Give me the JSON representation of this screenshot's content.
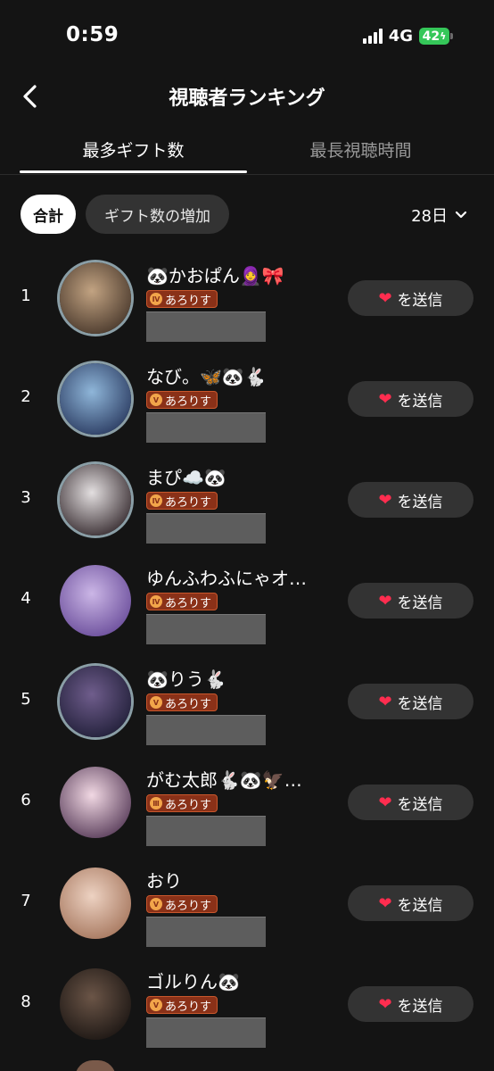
{
  "status_bar": {
    "time": "0:59",
    "network": "4G",
    "battery": "42"
  },
  "header": {
    "title": "視聴者ランキング"
  },
  "tabs": [
    {
      "label": "最多ギフト数",
      "active": true
    },
    {
      "label": "最長視聴時間",
      "active": false
    }
  ],
  "filters": {
    "chips": [
      {
        "label": "合計",
        "active": true
      },
      {
        "label": "ギフト数の増加",
        "active": false
      }
    ],
    "period": "28日"
  },
  "send_label": "を送信",
  "rows": [
    {
      "rank": "1",
      "name": "🐼かおぱん🧕🎀",
      "badge": "あろりす",
      "badge_level": "Ⅳ",
      "avatar_colors": [
        "#c2a382",
        "#4b3a2d"
      ],
      "framed": true
    },
    {
      "rank": "2",
      "name": "なび。🦋🐼🐇",
      "badge": "あろりす",
      "badge_level": "Ⅴ",
      "avatar_colors": [
        "#8fb6d9",
        "#2c3d63"
      ],
      "framed": true
    },
    {
      "rank": "3",
      "name": "まぴ☁️🐼",
      "badge": "あろりす",
      "badge_level": "Ⅳ",
      "avatar_colors": [
        "#e3dfe0",
        "#3a2f33"
      ],
      "framed": true
    },
    {
      "rank": "4",
      "name": "ゆんふわふにゃオ…",
      "badge": "あろりす",
      "badge_level": "Ⅳ",
      "avatar_colors": [
        "#cbb6e6",
        "#6c4f9c"
      ],
      "framed": false
    },
    {
      "rank": "5",
      "name": "🐼りう🐇",
      "badge": "あろりす",
      "badge_level": "Ⅴ",
      "avatar_colors": [
        "#6f5d8c",
        "#22203a"
      ],
      "framed": true
    },
    {
      "rank": "6",
      "name": "がむ太郎🐇🐼🦅…",
      "badge": "あろりす",
      "badge_level": "Ⅲ",
      "avatar_colors": [
        "#f1d8e3",
        "#5b3f5c"
      ],
      "framed": false
    },
    {
      "rank": "7",
      "name": "おり",
      "badge": "あろりす",
      "badge_level": "Ⅴ",
      "avatar_colors": [
        "#edd2c2",
        "#a7785f"
      ],
      "framed": false
    },
    {
      "rank": "8",
      "name": "ゴルりん🐼",
      "badge": "あろりす",
      "badge_level": "Ⅴ",
      "avatar_colors": [
        "#6b5547",
        "#1d1714"
      ],
      "framed": false
    }
  ],
  "colors": {
    "background": "#141414",
    "badge": "#8a3118",
    "heart": "#ff2d4f",
    "battery": "#35c759"
  }
}
